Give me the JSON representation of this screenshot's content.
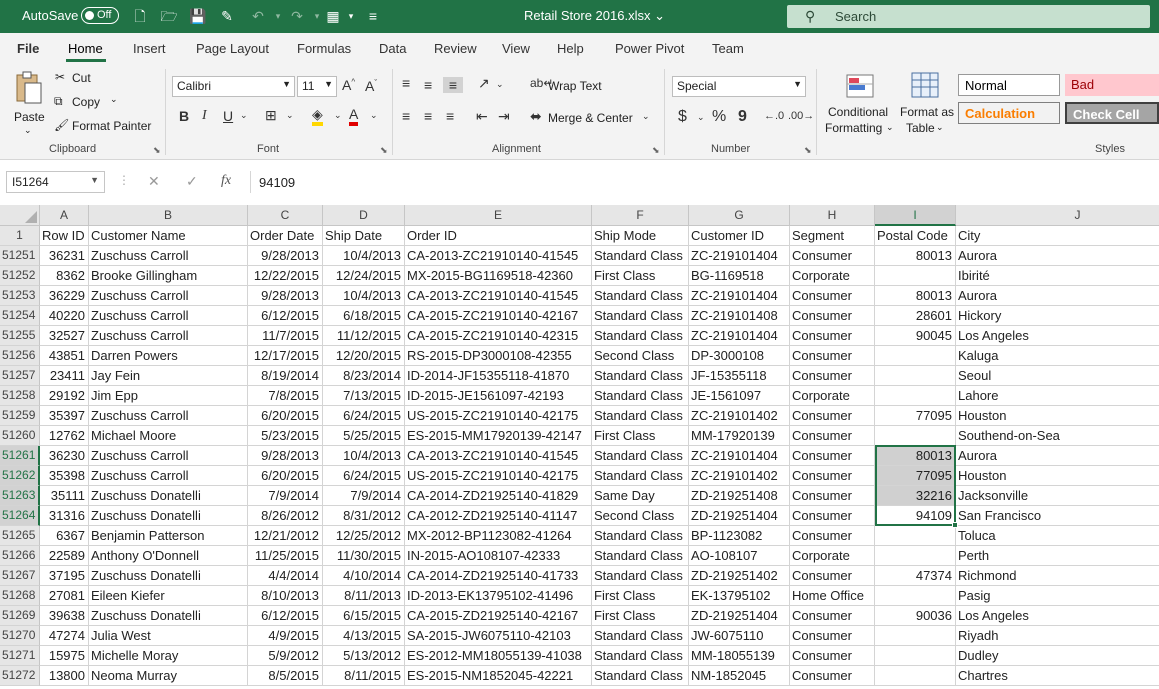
{
  "titlebar": {
    "autosave_label": "AutoSave",
    "autosave_state": "Off",
    "filename": "Retail Store 2016.xlsx",
    "filename_arrow": "⌄",
    "search_placeholder": "Search"
  },
  "tabs": [
    "File",
    "Home",
    "Insert",
    "Page Layout",
    "Formulas",
    "Data",
    "Review",
    "View",
    "Help",
    "Power Pivot",
    "Team"
  ],
  "ribbon": {
    "clipboard": {
      "paste": "Paste",
      "cut": "Cut",
      "copy": "Copy",
      "format_painter": "Format Painter",
      "label": "Clipboard"
    },
    "font": {
      "name": "Calibri",
      "size": "11",
      "label": "Font",
      "bold": "B",
      "italic": "I",
      "underline": "U"
    },
    "alignment": {
      "wrap_text": "Wrap Text",
      "merge_center": "Merge & Center",
      "label": "Alignment"
    },
    "number": {
      "format": "Special",
      "label": "Number",
      "currency": "$",
      "percent": "%",
      "comma": "9"
    },
    "styles": {
      "conditional_1": "Conditional",
      "conditional_2": "Formatting",
      "format_table_1": "Format as",
      "format_table_2": "Table",
      "normal": "Normal",
      "bad": "Bad",
      "calculation": "Calculation",
      "check_cell": "Check Cell",
      "label": "Styles"
    }
  },
  "formula_bar": {
    "name_box": "I51264",
    "fx": "fx",
    "value": "94109"
  },
  "columns": [
    {
      "letter": "A",
      "header": "Row ID"
    },
    {
      "letter": "B",
      "header": "Customer Name"
    },
    {
      "letter": "C",
      "header": "Order Date"
    },
    {
      "letter": "D",
      "header": "Ship Date"
    },
    {
      "letter": "E",
      "header": "Order ID"
    },
    {
      "letter": "F",
      "header": "Ship Mode"
    },
    {
      "letter": "G",
      "header": "Customer ID"
    },
    {
      "letter": "H",
      "header": "Segment"
    },
    {
      "letter": "I",
      "header": "Postal Code"
    },
    {
      "letter": "J",
      "header": "City"
    }
  ],
  "rows": [
    {
      "n": "51251",
      "cells": [
        "36231",
        "Zuschuss Carroll",
        "9/28/2013",
        "10/4/2013",
        "CA-2013-ZC21910140-41545",
        "Standard Class",
        "ZC-219101404",
        "Consumer",
        "80013",
        "Aurora"
      ]
    },
    {
      "n": "51252",
      "cells": [
        "8362",
        "Brooke Gillingham",
        "12/22/2015",
        "12/24/2015",
        "MX-2015-BG1169518-42360",
        "First Class",
        "BG-1169518",
        "Corporate",
        "",
        "Ibirité"
      ]
    },
    {
      "n": "51253",
      "cells": [
        "36229",
        "Zuschuss Carroll",
        "9/28/2013",
        "10/4/2013",
        "CA-2013-ZC21910140-41545",
        "Standard Class",
        "ZC-219101404",
        "Consumer",
        "80013",
        "Aurora"
      ]
    },
    {
      "n": "51254",
      "cells": [
        "40220",
        "Zuschuss Carroll",
        "6/12/2015",
        "6/18/2015",
        "CA-2015-ZC21910140-42167",
        "Standard Class",
        "ZC-219101408",
        "Consumer",
        "28601",
        "Hickory"
      ]
    },
    {
      "n": "51255",
      "cells": [
        "32527",
        "Zuschuss Carroll",
        "11/7/2015",
        "11/12/2015",
        "CA-2015-ZC21910140-42315",
        "Standard Class",
        "ZC-219101404",
        "Consumer",
        "90045",
        "Los Angeles"
      ]
    },
    {
      "n": "51256",
      "cells": [
        "43851",
        "Darren Powers",
        "12/17/2015",
        "12/20/2015",
        "RS-2015-DP3000108-42355",
        "Second Class",
        "DP-3000108",
        "Consumer",
        "",
        "Kaluga"
      ]
    },
    {
      "n": "51257",
      "cells": [
        "23411",
        "Jay Fein",
        "8/19/2014",
        "8/23/2014",
        "ID-2014-JF15355118-41870",
        "Standard Class",
        "JF-15355118",
        "Consumer",
        "",
        "Seoul"
      ]
    },
    {
      "n": "51258",
      "cells": [
        "29192",
        "Jim Epp",
        "7/8/2015",
        "7/13/2015",
        "ID-2015-JE1561097-42193",
        "Standard Class",
        "JE-1561097",
        "Corporate",
        "",
        "Lahore"
      ]
    },
    {
      "n": "51259",
      "cells": [
        "35397",
        "Zuschuss Carroll",
        "6/20/2015",
        "6/24/2015",
        "US-2015-ZC21910140-42175",
        "Standard Class",
        "ZC-219101402",
        "Consumer",
        "77095",
        "Houston"
      ]
    },
    {
      "n": "51260",
      "cells": [
        "12762",
        "Michael Moore",
        "5/23/2015",
        "5/25/2015",
        "ES-2015-MM17920139-42147",
        "First Class",
        "MM-17920139",
        "Consumer",
        "",
        "Southend-on-Sea"
      ]
    },
    {
      "n": "51261",
      "cells": [
        "36230",
        "Zuschuss Carroll",
        "9/28/2013",
        "10/4/2013",
        "CA-2013-ZC21910140-41545",
        "Standard Class",
        "ZC-219101404",
        "Consumer",
        "80013",
        "Aurora"
      ]
    },
    {
      "n": "51262",
      "cells": [
        "35398",
        "Zuschuss Carroll",
        "6/20/2015",
        "6/24/2015",
        "US-2015-ZC21910140-42175",
        "Standard Class",
        "ZC-219101402",
        "Consumer",
        "77095",
        "Houston"
      ]
    },
    {
      "n": "51263",
      "cells": [
        "35111",
        "Zuschuss Donatelli",
        "7/9/2014",
        "7/9/2014",
        "CA-2014-ZD21925140-41829",
        "Same Day",
        "ZD-219251408",
        "Consumer",
        "32216",
        "Jacksonville"
      ]
    },
    {
      "n": "51264",
      "cells": [
        "31316",
        "Zuschuss Donatelli",
        "8/26/2012",
        "8/31/2012",
        "CA-2012-ZD21925140-41147",
        "Second Class",
        "ZD-219251404",
        "Consumer",
        "94109",
        "San Francisco"
      ]
    },
    {
      "n": "51265",
      "cells": [
        "6367",
        "Benjamin Patterson",
        "12/21/2012",
        "12/25/2012",
        "MX-2012-BP1123082-41264",
        "Standard Class",
        "BP-1123082",
        "Consumer",
        "",
        "Toluca"
      ]
    },
    {
      "n": "51266",
      "cells": [
        "22589",
        "Anthony O'Donnell",
        "11/25/2015",
        "11/30/2015",
        "IN-2015-AO108107-42333",
        "Standard Class",
        "AO-108107",
        "Corporate",
        "",
        "Perth"
      ]
    },
    {
      "n": "51267",
      "cells": [
        "37195",
        "Zuschuss Donatelli",
        "4/4/2014",
        "4/10/2014",
        "CA-2014-ZD21925140-41733",
        "Standard Class",
        "ZD-219251402",
        "Consumer",
        "47374",
        "Richmond"
      ]
    },
    {
      "n": "51268",
      "cells": [
        "27081",
        "Eileen Kiefer",
        "8/10/2013",
        "8/11/2013",
        "ID-2013-EK13795102-41496",
        "First Class",
        "EK-13795102",
        "Home Office",
        "",
        "Pasig"
      ]
    },
    {
      "n": "51269",
      "cells": [
        "39638",
        "Zuschuss Donatelli",
        "6/12/2015",
        "6/15/2015",
        "CA-2015-ZD21925140-42167",
        "First Class",
        "ZD-219251404",
        "Consumer",
        "90036",
        "Los Angeles"
      ]
    },
    {
      "n": "51270",
      "cells": [
        "47274",
        "Julia West",
        "4/9/2015",
        "4/13/2015",
        "SA-2015-JW6075110-42103",
        "Standard Class",
        "JW-6075110",
        "Consumer",
        "",
        "Riyadh"
      ]
    },
    {
      "n": "51271",
      "cells": [
        "15975",
        "Michelle Moray",
        "5/9/2012",
        "5/13/2012",
        "ES-2012-MM18055139-41038",
        "Standard Class",
        "MM-18055139",
        "Consumer",
        "",
        "Dudley"
      ]
    },
    {
      "n": "51272",
      "cells": [
        "13800",
        "Neoma Murray",
        "8/5/2015",
        "8/11/2015",
        "ES-2015-NM1852045-42221",
        "Standard Class",
        "NM-1852045",
        "Consumer",
        "",
        "Chartres"
      ]
    }
  ],
  "selected_rows": [
    "51261",
    "51262",
    "51263",
    "51264"
  ],
  "active_cell": "I51264",
  "colors": {
    "accent": "#217346",
    "bad_bg": "#ffc7ce",
    "bad_fg": "#9c0006",
    "calc_fg": "#fa7d00",
    "check_bg": "#a5a5a5"
  }
}
